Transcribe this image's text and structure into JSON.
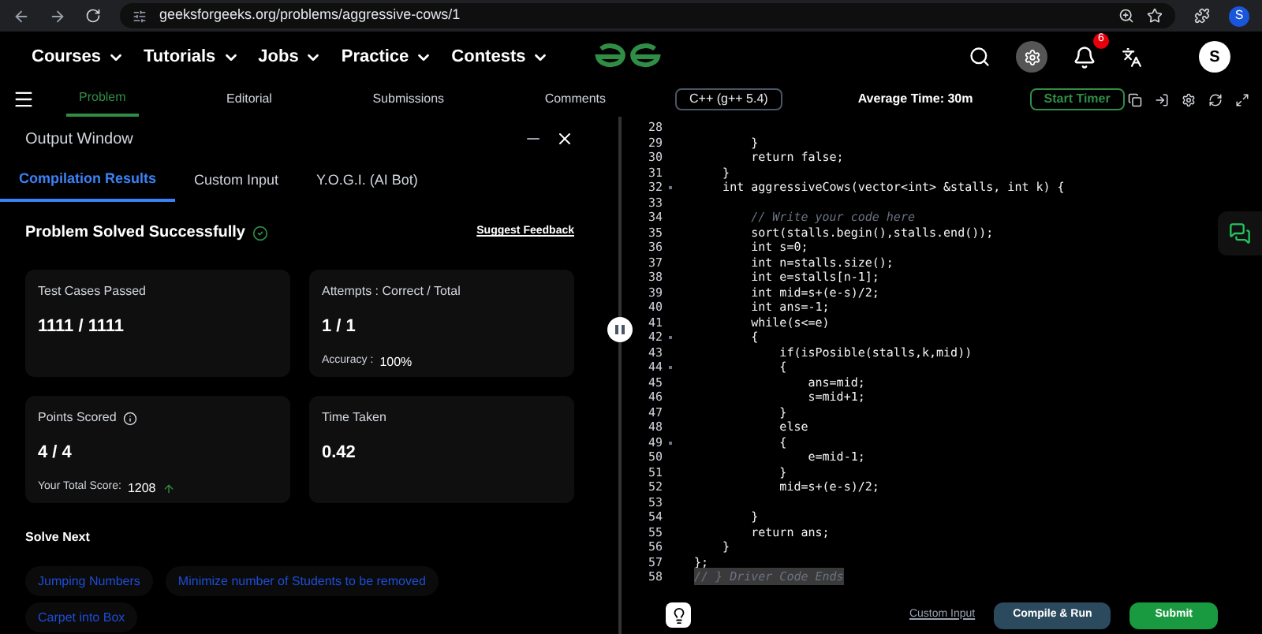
{
  "browser": {
    "url": "geeksforgeeks.org/problems/aggressive-cows/1",
    "profile_initial": "S"
  },
  "nav": {
    "menus": [
      "Courses",
      "Tutorials",
      "Jobs",
      "Practice",
      "Contests"
    ],
    "notification_count": "6",
    "avatar_initial": "S"
  },
  "problem_tabs": [
    {
      "label": "Problem",
      "selected": true
    },
    {
      "label": "Editorial",
      "selected": false
    },
    {
      "label": "Submissions",
      "selected": false
    },
    {
      "label": "Comments",
      "selected": false
    }
  ],
  "language": "C++ (g++ 5.4)",
  "average_time": "Average Time: 30m",
  "timer_button": "Start Timer",
  "output_window": {
    "title": "Output Window",
    "tabs": [
      {
        "label": "Compilation Results",
        "selected": true
      },
      {
        "label": "Custom Input",
        "selected": false
      },
      {
        "label": "Y.O.G.I. (AI Bot)",
        "selected": false
      }
    ],
    "status": "Problem Solved Successfully",
    "feedback_link": "Suggest Feedback",
    "cards": [
      {
        "title": "Test Cases Passed",
        "value": "1111 / 1111"
      },
      {
        "title": "Attempts : Correct / Total",
        "value": "1 / 1",
        "note_label": "Accuracy :",
        "note_value": "100%"
      },
      {
        "title": "Points Scored",
        "value": "4 / 4",
        "info": true,
        "note_label": "Your Total Score:",
        "note_value": "1208",
        "trend_up": true
      },
      {
        "title": "Time Taken",
        "value": "0.42"
      }
    ],
    "solve_next_title": "Solve Next",
    "solve_next": [
      "Jumping Numbers",
      "Minimize number of Students to be removed",
      "Carpet into Box"
    ]
  },
  "editor": {
    "lines": [
      {
        "number": "28"
      },
      {
        "number": "29",
        "text": "        }"
      },
      {
        "number": "30",
        "text": "        return false;"
      },
      {
        "number": "31",
        "text": "    }"
      },
      {
        "number": "32",
        "text": "    int aggressiveCows(vector<int> &stalls, int k) {",
        "foldable": true
      },
      {
        "number": "33"
      },
      {
        "number": "34",
        "text": "        // Write your code here",
        "kind": "comment"
      },
      {
        "number": "35",
        "text": "        sort(stalls.begin(),stalls.end());"
      },
      {
        "number": "36",
        "text": "        int s=0;"
      },
      {
        "number": "37",
        "text": "        int n=stalls.size();"
      },
      {
        "number": "38",
        "text": "        int e=stalls[n-1];"
      },
      {
        "number": "39",
        "text": "        int mid=s+(e-s)/2;"
      },
      {
        "number": "40",
        "text": "        int ans=-1;"
      },
      {
        "number": "41",
        "text": "        while(s<=e)"
      },
      {
        "number": "42",
        "text": "        {",
        "foldable": true
      },
      {
        "number": "43",
        "text": "            if(isPosible(stalls,k,mid))"
      },
      {
        "number": "44",
        "text": "            {",
        "foldable": true
      },
      {
        "number": "45",
        "text": "                ans=mid;"
      },
      {
        "number": "46",
        "text": "                s=mid+1;"
      },
      {
        "number": "47",
        "text": "            }"
      },
      {
        "number": "48",
        "text": "            else"
      },
      {
        "number": "49",
        "text": "            {",
        "foldable": true
      },
      {
        "number": "50",
        "text": "                e=mid-1;"
      },
      {
        "number": "51",
        "text": "            }"
      },
      {
        "number": "52",
        "text": "            mid=s+(e-s)/2;"
      },
      {
        "number": "53"
      },
      {
        "number": "54",
        "text": "        }"
      },
      {
        "number": "55",
        "text": "        return ans;"
      },
      {
        "number": "56",
        "text": "    }"
      },
      {
        "number": "57",
        "text": "};"
      },
      {
        "number": "58",
        "text": "// } Driver Code Ends",
        "kind": "comment",
        "highlighted": true
      }
    ],
    "custom_input_link": "Custom Input",
    "run_button": "Compile & Run",
    "submit_button": "Submit"
  }
}
